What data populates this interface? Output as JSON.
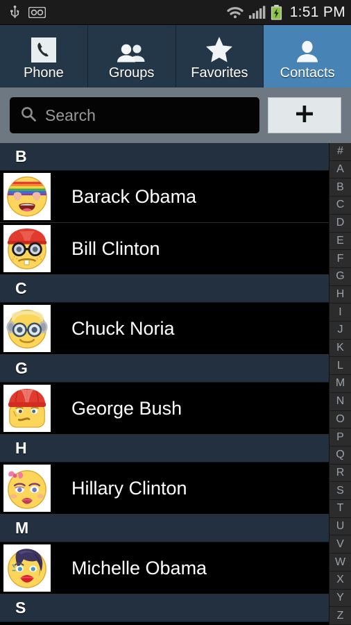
{
  "statusbar": {
    "time": "1:51 PM",
    "icons": [
      "usb-icon",
      "voicemail-icon",
      "wifi-icon",
      "signal-icon",
      "battery-charging-icon"
    ]
  },
  "tabs": [
    {
      "label": "Phone",
      "icon": "phone-handset-icon",
      "active": false
    },
    {
      "label": "Groups",
      "icon": "people-group-icon",
      "active": false
    },
    {
      "label": "Favorites",
      "icon": "star-icon",
      "active": false
    },
    {
      "label": "Contacts",
      "icon": "person-icon",
      "active": true
    }
  ],
  "search": {
    "placeholder": "Search",
    "value": "",
    "icon": "search-icon"
  },
  "add_button": {
    "label": "+",
    "icon": "plus-icon"
  },
  "list": [
    {
      "type": "header",
      "letter": "B"
    },
    {
      "type": "contact",
      "name": "Barack Obama",
      "avatar": "emoji-rainbow-heart-sunglasses"
    },
    {
      "type": "contact",
      "name": "Bill Clinton",
      "avatar": "emoji-nerd-red-cap"
    },
    {
      "type": "header",
      "letter": "C"
    },
    {
      "type": "contact",
      "name": "Chuck Noria",
      "avatar": "emoji-old-man-glasses"
    },
    {
      "type": "header",
      "letter": "G"
    },
    {
      "type": "contact",
      "name": "George Bush",
      "avatar": "emoji-grumpy-red-beanie"
    },
    {
      "type": "header",
      "letter": "H"
    },
    {
      "type": "contact",
      "name": "Hillary Clinton",
      "avatar": "emoji-woman-pink-bow"
    },
    {
      "type": "header",
      "letter": "M"
    },
    {
      "type": "contact",
      "name": "Michelle Obama",
      "avatar": "emoji-woman-dark-hair-red-lips"
    },
    {
      "type": "header",
      "letter": "S"
    }
  ],
  "index_scrubber": [
    "#",
    "A",
    "B",
    "C",
    "D",
    "E",
    "F",
    "G",
    "H",
    "I",
    "J",
    "K",
    "L",
    "M",
    "N",
    "O",
    "P",
    "Q",
    "R",
    "S",
    "T",
    "U",
    "V",
    "W",
    "X",
    "Y",
    "Z"
  ],
  "colors": {
    "statusbar_bg": "#1b1b1b",
    "tab_bg": "#243748",
    "tab_active_bg": "#4784b5",
    "search_row_bg": "#6d7883",
    "section_header_bg": "#22303f",
    "list_bg": "#000000",
    "scrubber_bg": "#2c2c2c",
    "battery_green": "#8bc53f",
    "text_primary": "#ffffff",
    "text_muted": "#9aa3ab"
  }
}
